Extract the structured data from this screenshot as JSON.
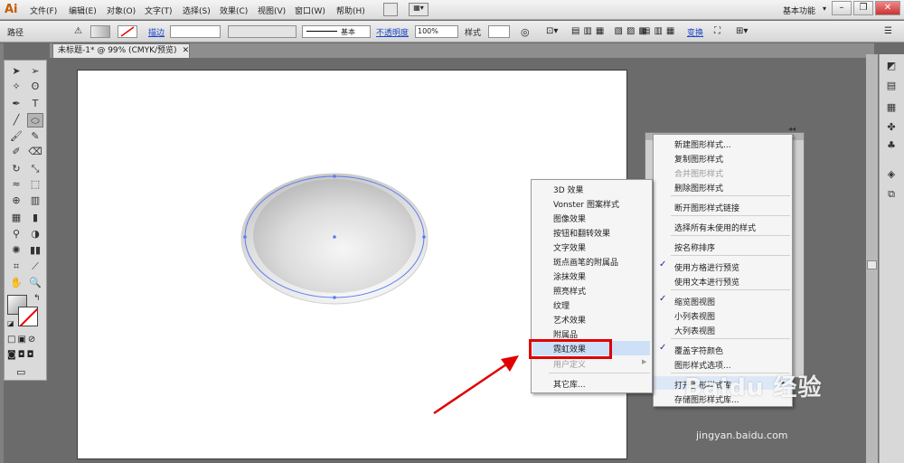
{
  "app": {
    "logo": "Ai",
    "workspace": "基本功能"
  },
  "menu": [
    "文件(F)",
    "编辑(E)",
    "对象(O)",
    "文字(T)",
    "选择(S)",
    "效果(C)",
    "视图(V)",
    "窗口(W)",
    "帮助(H)"
  ],
  "control": {
    "object_type": "路径",
    "stroke_label": "描边",
    "stroke_style": "基本",
    "opacity_label": "不透明度",
    "opacity_value": "100%",
    "style_label": "样式",
    "transform_label": "变换"
  },
  "document": {
    "tab_title": "未标题-1* @ 99% (CMYK/预览)"
  },
  "panel_menu": {
    "items": [
      {
        "label": "新建图形样式..."
      },
      {
        "label": "复制图形样式"
      },
      {
        "label": "合并图形样式",
        "disabled": true
      },
      {
        "label": "删除图形样式"
      },
      {
        "label": "断开图形样式链接"
      },
      {
        "label": "选择所有未使用的样式"
      },
      {
        "label": "按名称排序"
      },
      {
        "label": "使用方格进行预览",
        "checked": true
      },
      {
        "label": "使用文本进行预览"
      },
      {
        "label": "缩览图视图",
        "checked": true
      },
      {
        "label": "小列表视图"
      },
      {
        "label": "大列表视图"
      },
      {
        "label": "覆盖字符颜色",
        "checked": true
      },
      {
        "label": "图形样式选项..."
      },
      {
        "label": "打开图形样式库"
      },
      {
        "label": "存储图形样式库..."
      }
    ]
  },
  "library_menu": {
    "items": [
      "3D 效果",
      "Vonster 图案样式",
      "图像效果",
      "按钮和翻转效果",
      "文字效果",
      "斑点画笔的附属品",
      "涂抹效果",
      "照亮样式",
      "纹理",
      "艺术效果",
      "附属品",
      "霓虹效果",
      "用户定义",
      "其它库..."
    ],
    "highlighted": "霓虹效果"
  },
  "watermark": {
    "brand": "Baidu 经验",
    "url": "jingyan.baidu.com"
  },
  "colors": {
    "highlight_box": "#e00000",
    "arrow": "#e00000"
  }
}
